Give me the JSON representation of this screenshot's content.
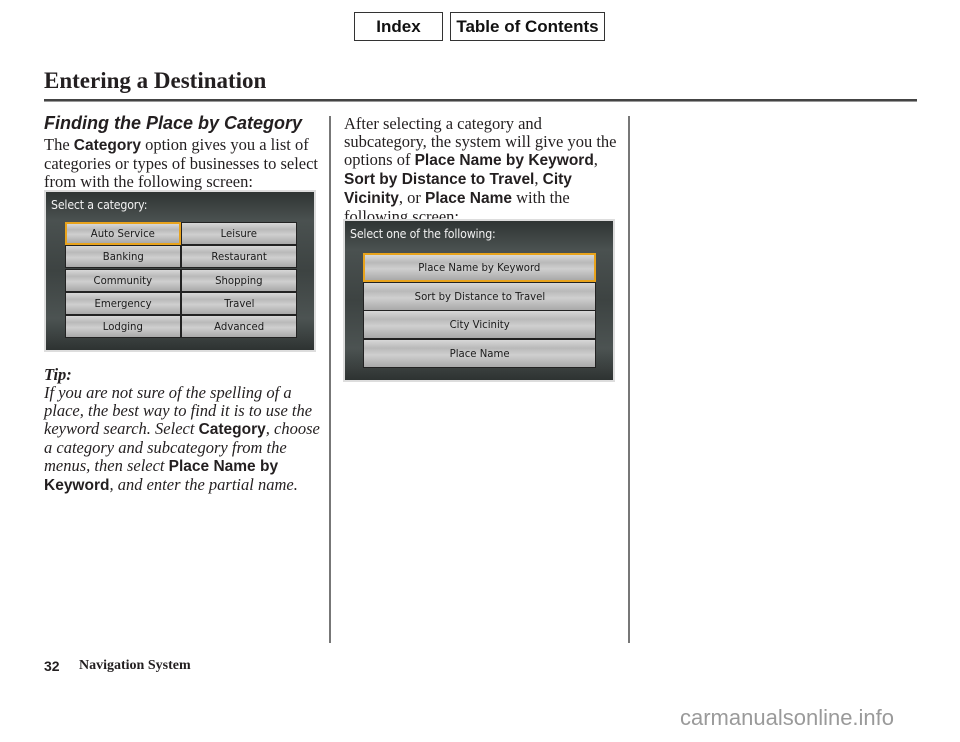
{
  "nav": {
    "index_label": "Index",
    "toc_label": "Table of Contents"
  },
  "page": {
    "title": "Entering a Destination"
  },
  "left_column": {
    "heading": "Finding the Place by Category",
    "intro": {
      "t1": "The ",
      "b1": "Category",
      "t2": " option gives you a list of categories or types of businesses to select from with the following screen:"
    },
    "tip": {
      "label": "Tip:",
      "t1": "If you are not sure of the spelling of a place, the best way to find it is to use the keyword search. Select ",
      "b1": "Category",
      "t2": ", choose a category and subcategory from the menus, then select ",
      "b2": "Place Name by Keyword",
      "t3": ", and enter the partial name."
    }
  },
  "category_screen": {
    "title": "Select a category:",
    "selected": "Auto Service",
    "left_options": [
      "Auto Service",
      "Banking",
      "Community",
      "Emergency",
      "Lodging"
    ],
    "right_options": [
      "Leisure",
      "Restaurant",
      "Shopping",
      "Travel",
      "Advanced"
    ]
  },
  "right_column": {
    "t1": "After selecting a category and subcategory, the system will give you the options of ",
    "b1": "Place Name by Keyword",
    "t2": ", ",
    "b2": "Sort by Distance to Travel",
    "t3": ", ",
    "b3": "City Vicinity",
    "t4": ", or ",
    "b4": "Place Name",
    "t5": " with the following screen:"
  },
  "options_screen": {
    "title": "Select one of the following:",
    "selected": "Place Name by Keyword",
    "options": [
      "Place Name by Keyword",
      "Sort by Distance to Travel",
      "City Vicinity",
      "Place Name"
    ]
  },
  "footer": {
    "page_number": "32",
    "label": "Navigation System"
  },
  "watermark": "carmanualsonline.info",
  "colors": {
    "selection_highlight": "#e8a31c",
    "text": "#231f20"
  }
}
